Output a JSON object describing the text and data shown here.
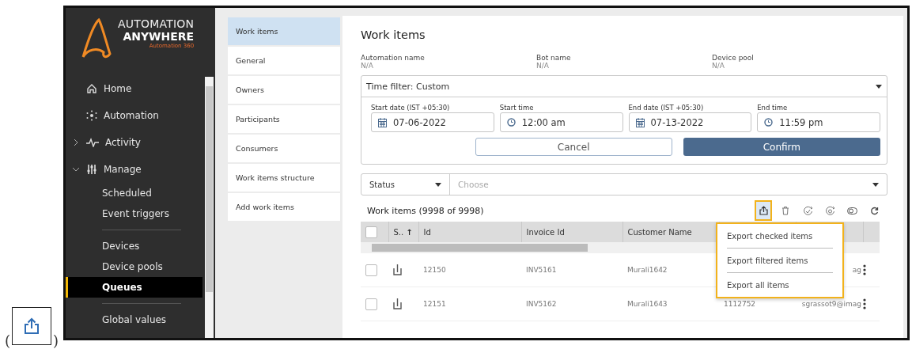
{
  "sidebar": {
    "logo": {
      "line_1": "AUTOMATION",
      "line_2": "ANYWHERE",
      "tagline": "Automation 360"
    },
    "items": [
      {
        "label": "Home",
        "selected": false
      },
      {
        "label": "Automation",
        "selected": false
      },
      {
        "label": "Activity",
        "selected": false,
        "expanded": false
      },
      {
        "label": "Manage",
        "selected": false,
        "expanded": true,
        "children": [
          {
            "kind": "item",
            "label": "Scheduled",
            "selected": false
          },
          {
            "kind": "item",
            "label": "Event triggers",
            "selected": false
          },
          {
            "kind": "divider"
          },
          {
            "kind": "item",
            "label": "Devices",
            "selected": false
          },
          {
            "kind": "item",
            "label": "Device pools",
            "selected": false
          },
          {
            "kind": "item",
            "label": "Queues",
            "selected": true
          },
          {
            "kind": "divider"
          },
          {
            "kind": "item",
            "label": "Global values",
            "selected": false
          }
        ]
      }
    ]
  },
  "subnav": [
    {
      "label": "Work items",
      "selected": true
    },
    {
      "label": "General",
      "selected": false
    },
    {
      "label": "Owners",
      "selected": false
    },
    {
      "label": "Participants",
      "selected": false
    },
    {
      "label": "Consumers",
      "selected": false
    },
    {
      "label": "Work items structure",
      "selected": false
    },
    {
      "label": "Add work items",
      "selected": false
    }
  ],
  "content": {
    "title": "Work items",
    "info": [
      {
        "label": "Automation name",
        "value": "N/A"
      },
      {
        "label": "Bot name",
        "value": "N/A"
      },
      {
        "label": "Device pool",
        "value": "N/A"
      }
    ],
    "time_filter": {
      "value": "Time filter: Custom",
      "expanded": true,
      "fields": [
        {
          "kind": "date",
          "label": "Start date (IST +05:30)",
          "value": "07-06-2022"
        },
        {
          "kind": "time",
          "label": "Start time",
          "value": "12:00 am"
        },
        {
          "kind": "date",
          "label": "End date (IST +05:30)",
          "value": "07-13-2022"
        },
        {
          "kind": "time",
          "label": "End time",
          "value": "11:59 pm"
        }
      ],
      "buttons": [
        {
          "kind": "secondary",
          "label": "Cancel"
        },
        {
          "kind": "primary",
          "label": "Confirm"
        }
      ]
    },
    "status_filter": {
      "field": "Status",
      "placeholder": "Choose"
    },
    "table": {
      "title": "Work items",
      "count": "(9998 of 9998)",
      "toolbar": [
        {
          "selected": true
        },
        {
          "selected": false
        },
        {
          "selected": false
        },
        {
          "selected": false
        },
        {
          "selected": false
        },
        {
          "selected": false
        }
      ],
      "header_checked": false,
      "columns": [
        {
          "label": "S..",
          "sort": "↑"
        },
        {
          "label": "Id"
        },
        {
          "label": "Invoice Id"
        },
        {
          "label": "Customer Name"
        }
      ],
      "rows": [
        {
          "checked": false,
          "cells": [
            "",
            "12150",
            "INV5161",
            "Murali1642",
            null,
            "ag"
          ]
        },
        {
          "checked": false,
          "cells": [
            "",
            "12151",
            "INV5162",
            "Murali1643",
            "1112752",
            "sgrassot9@imag"
          ]
        }
      ],
      "export_menu": [
        "Export checked items",
        "Export filtered items",
        "Export all items"
      ]
    }
  },
  "footnote": {
    "open": "(",
    "close": ")"
  }
}
